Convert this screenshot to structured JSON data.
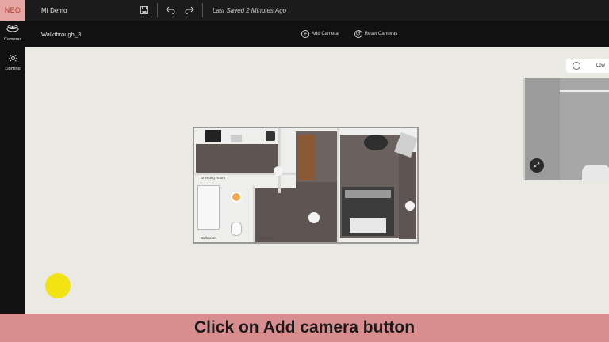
{
  "topbar": {
    "logo": "NEO",
    "project_name": "MI Demo",
    "last_saved": "Last Saved 2 Minutes Ago"
  },
  "subbar": {
    "walkthrough_name": "Walkthrough_3",
    "add_camera_label": "Add Camera",
    "reset_cameras_label": "Reset Cameras"
  },
  "sidebar": {
    "items": [
      {
        "label": "Cameras",
        "icon": "camera-stack-icon"
      },
      {
        "label": "Lighting",
        "icon": "sun-icon"
      }
    ]
  },
  "floorplan": {
    "rooms": [
      "Dressing Room",
      "Bathroom",
      "Bedroom"
    ]
  },
  "preview": {
    "quality_label": "Low"
  },
  "caption": "Click on Add camera button",
  "colors": {
    "logo_bg": "#e6a7a2",
    "caption_bg": "#d88e8f",
    "cursor_highlight": "#f2e315",
    "topbar_bg": "#1b1b1b"
  }
}
